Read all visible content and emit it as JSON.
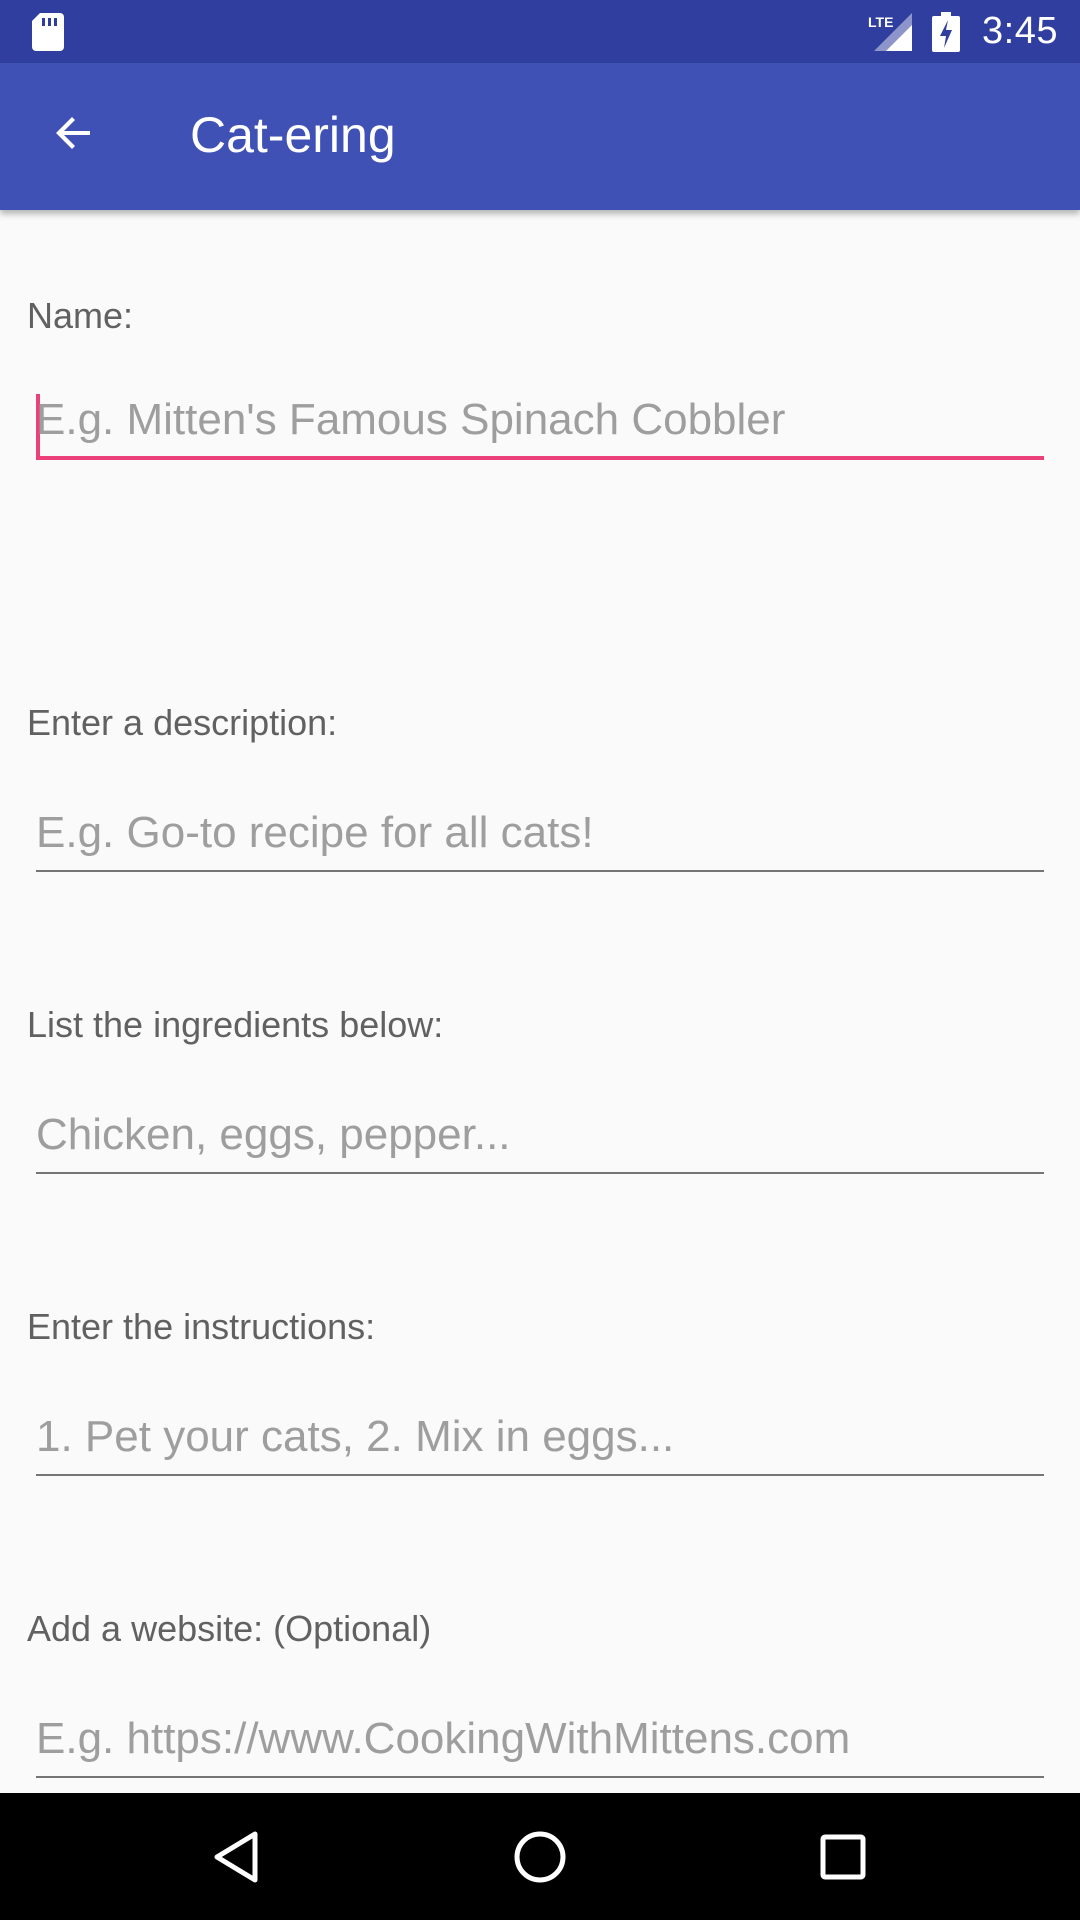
{
  "status_bar": {
    "time": "3:45",
    "network": "LTE",
    "icons": [
      "sd-card-icon",
      "lte-signal-icon",
      "battery-charging-icon"
    ]
  },
  "app_bar": {
    "title": "Cat-ering",
    "back_icon": "arrow-back-icon",
    "color": "#3f51b5"
  },
  "form": {
    "name": {
      "label": "Name:",
      "placeholder": "E.g. Mitten's Famous Spinach Cobbler",
      "value": ""
    },
    "description": {
      "label": "Enter a description:",
      "placeholder": "E.g. Go-to recipe for all cats!",
      "value": ""
    },
    "ingredients": {
      "label": "List the ingredients below:",
      "placeholder": "Chicken, eggs, pepper...",
      "value": ""
    },
    "instructions": {
      "label": "Enter the instructions:",
      "placeholder": "1. Pet your cats, 2. Mix in eggs...",
      "value": ""
    },
    "website": {
      "label": "Add a website: (Optional)",
      "placeholder": "E.g. https://www.CookingWithMittens.com",
      "value": ""
    },
    "accent_color": "#ec407a"
  },
  "nav_bar": {
    "icons": [
      "back-triangle-icon",
      "home-circle-icon",
      "recents-square-icon"
    ]
  }
}
